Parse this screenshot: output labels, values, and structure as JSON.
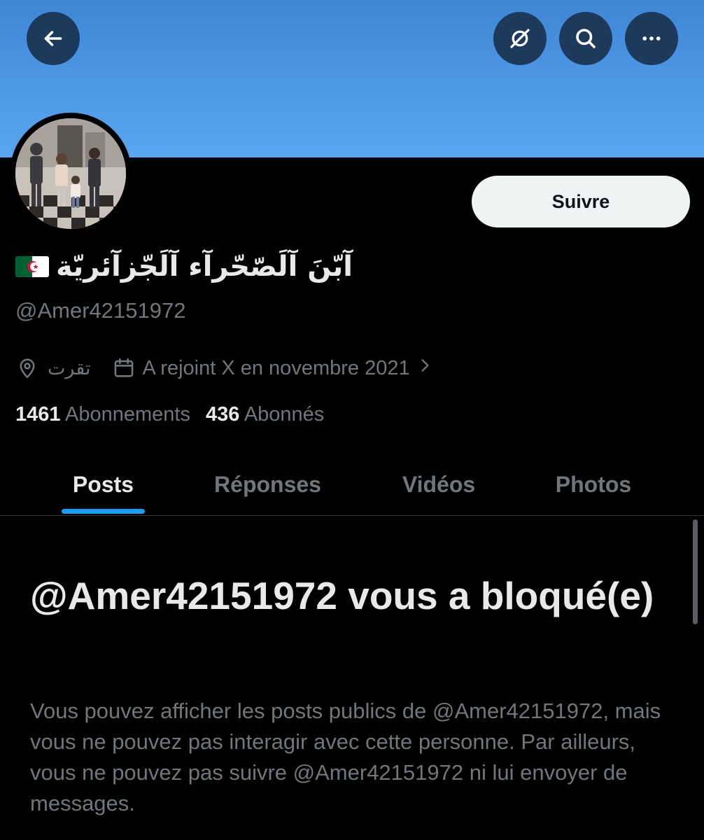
{
  "header": {
    "back_icon": "arrow-left-icon",
    "grok_icon": "grok-icon",
    "search_icon": "search-icon",
    "more_icon": "more-horizontal-icon",
    "banner_color": "#4d98e6"
  },
  "profile": {
    "display_name": "آبّنَ آلَصّحّرآء آلَجّزآئريّة",
    "flag_icon": "algeria-flag-icon",
    "handle": "@Amer42151972",
    "location": "تقرت",
    "joined": "A rejoint X en novembre 2021",
    "follow_label": "Suivre",
    "following_count": "1461",
    "following_label": "Abonnements",
    "followers_count": "436",
    "followers_label": "Abonnés"
  },
  "tabs": [
    {
      "label": "Posts",
      "active": true
    },
    {
      "label": "Réponses",
      "active": false
    },
    {
      "label": "Vidéos",
      "active": false
    },
    {
      "label": "Photos",
      "active": false
    }
  ],
  "blocked": {
    "title": "@Amer42151972 vous a bloqué(e)",
    "description": "Vous pouvez afficher les posts publics de @Amer42151972, mais vous ne pouvez pas interagir avec cette personne. Par ailleurs, vous ne pouvez pas suivre @Amer42151972 ni lui envoyer de messages."
  },
  "colors": {
    "accent": "#1d9bf0",
    "background": "#000000",
    "muted_text": "#71767b",
    "primary_text": "#e7e9ea"
  }
}
